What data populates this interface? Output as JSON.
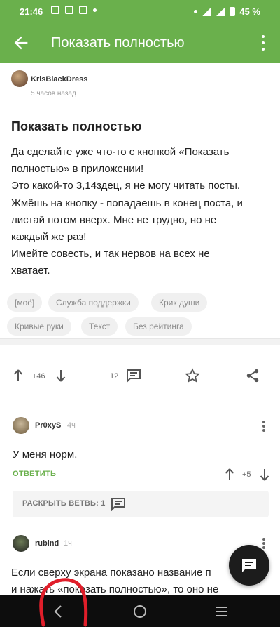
{
  "status_bar": {
    "time": "21:46",
    "battery": "45 %"
  },
  "app_bar": {
    "title": "Показать полностью"
  },
  "post": {
    "author": "KrisBlackDress",
    "time": "5 часов назад",
    "title": "Показать полностью",
    "body_lines": [
      "Да сделайте уже что-то с кнопкой «Показать",
      "полностью» в приложении!",
      "Это какой-то 3,14здец, я не могу читать посты.",
      "Жмёшь на кнопку - попадаешь в конец поста, и",
      "листай потом вверх. Мне не трудно, но не",
      "каждый же раз!",
      "Имейте совесть, и так нервов на всех не",
      "хватает."
    ],
    "tags": [
      "[моё]",
      "Служба поддержки",
      "Крик души",
      "Кривые руки",
      "Текст",
      "Без рейтинга"
    ],
    "rating": "+46",
    "comments_count": "12"
  },
  "comments": [
    {
      "author": "Pr0xyS",
      "time": "4ч",
      "text": "У меня норм.",
      "reply_label": "ОТВЕТИТЬ",
      "rating": "+5",
      "expand_label": "РАСКРЫТЬ ВЕТВЬ: 1"
    },
    {
      "author": "rubind",
      "time": "1ч",
      "text_lines": [
        "Если сверху экрана показано название п",
        "и нажать «показать полностью», то оно не"
      ]
    }
  ],
  "colors": {
    "brand": "#6ab04c",
    "nav": "#0d0d0d",
    "annotation": "#e01e2a"
  },
  "icons": [
    "back-arrow-icon",
    "more-vert-icon",
    "arrow-up-icon",
    "arrow-down-icon",
    "comment-icon",
    "star-icon",
    "share-icon",
    "message-icon",
    "nav-back-icon",
    "nav-home-icon",
    "nav-recents-icon"
  ]
}
